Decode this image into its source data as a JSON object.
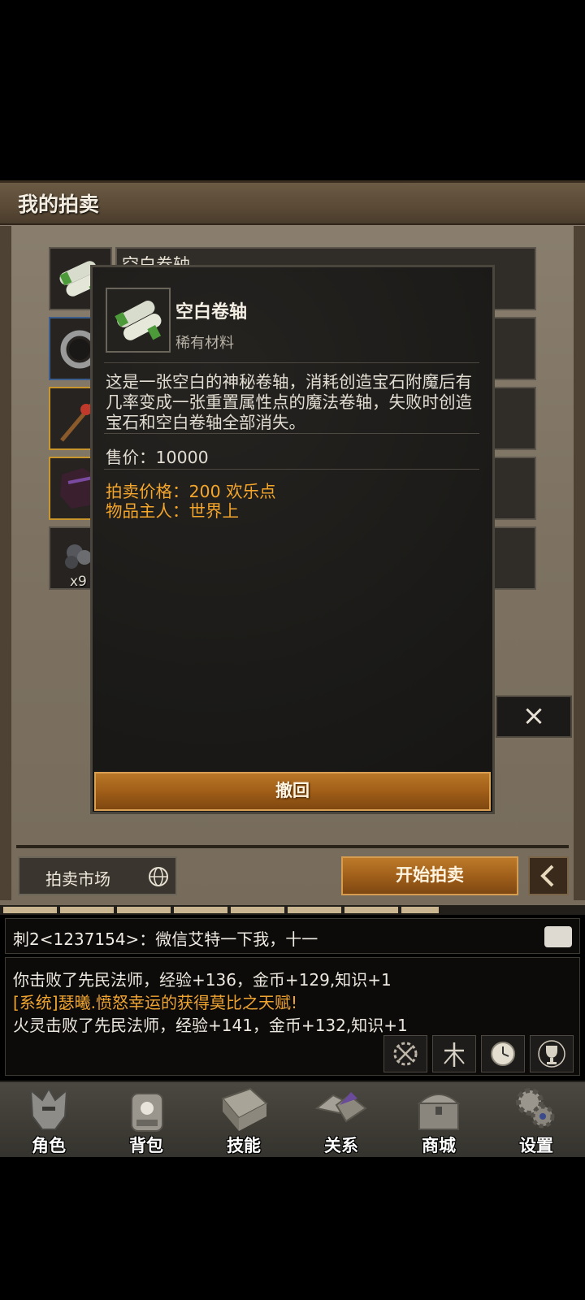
{
  "panel": {
    "title": "我的拍卖"
  },
  "listing": {
    "rows": [
      {
        "name": "空白卷轴"
      }
    ],
    "stack_qty": "x9",
    "close_glyph": "×"
  },
  "popup": {
    "item_name": "空白卷轴",
    "item_type": "稀有材料",
    "description": "这是一张空白的神秘卷轴，消耗创造宝石附魔后有几率变成一张重置属性点的魔法卷轴，失败时创造宝石和空白卷轴全部消失。",
    "price_line": "售价：10000",
    "auction_price": "拍卖价格：200 欢乐点",
    "owner": "物品主人：世界上",
    "revoke_label": "撤回"
  },
  "footer": {
    "market_label": "拍卖市场",
    "start_label": "开始拍卖"
  },
  "chat": {
    "top_message": "刺2<1237154>：微信艾特一下我，十一",
    "lines": [
      {
        "text": "你击败了先民法师，经验+136，金币+129,知识+1",
        "system": false
      },
      {
        "text": "[系统]瑟曦.愤怒幸运的获得莫比之天赋!",
        "system": true
      },
      {
        "text": "火灵击败了先民法师，经验+141，金币+132,知识+1",
        "system": false
      }
    ],
    "tools": [
      "combat-gear-icon",
      "tree-icon",
      "clock-icon",
      "trophy-icon"
    ]
  },
  "nav": {
    "items": [
      {
        "label": "角色",
        "icon": "helmet-icon"
      },
      {
        "label": "背包",
        "icon": "backpack-icon"
      },
      {
        "label": "技能",
        "icon": "skill-book-icon"
      },
      {
        "label": "关系",
        "icon": "handshake-icon"
      },
      {
        "label": "商城",
        "icon": "treasure-chest-icon"
      },
      {
        "label": "设置",
        "icon": "gear-icon"
      }
    ]
  },
  "colors": {
    "accent_orange": "#f4a52b",
    "button_gold": "#a1601a"
  }
}
